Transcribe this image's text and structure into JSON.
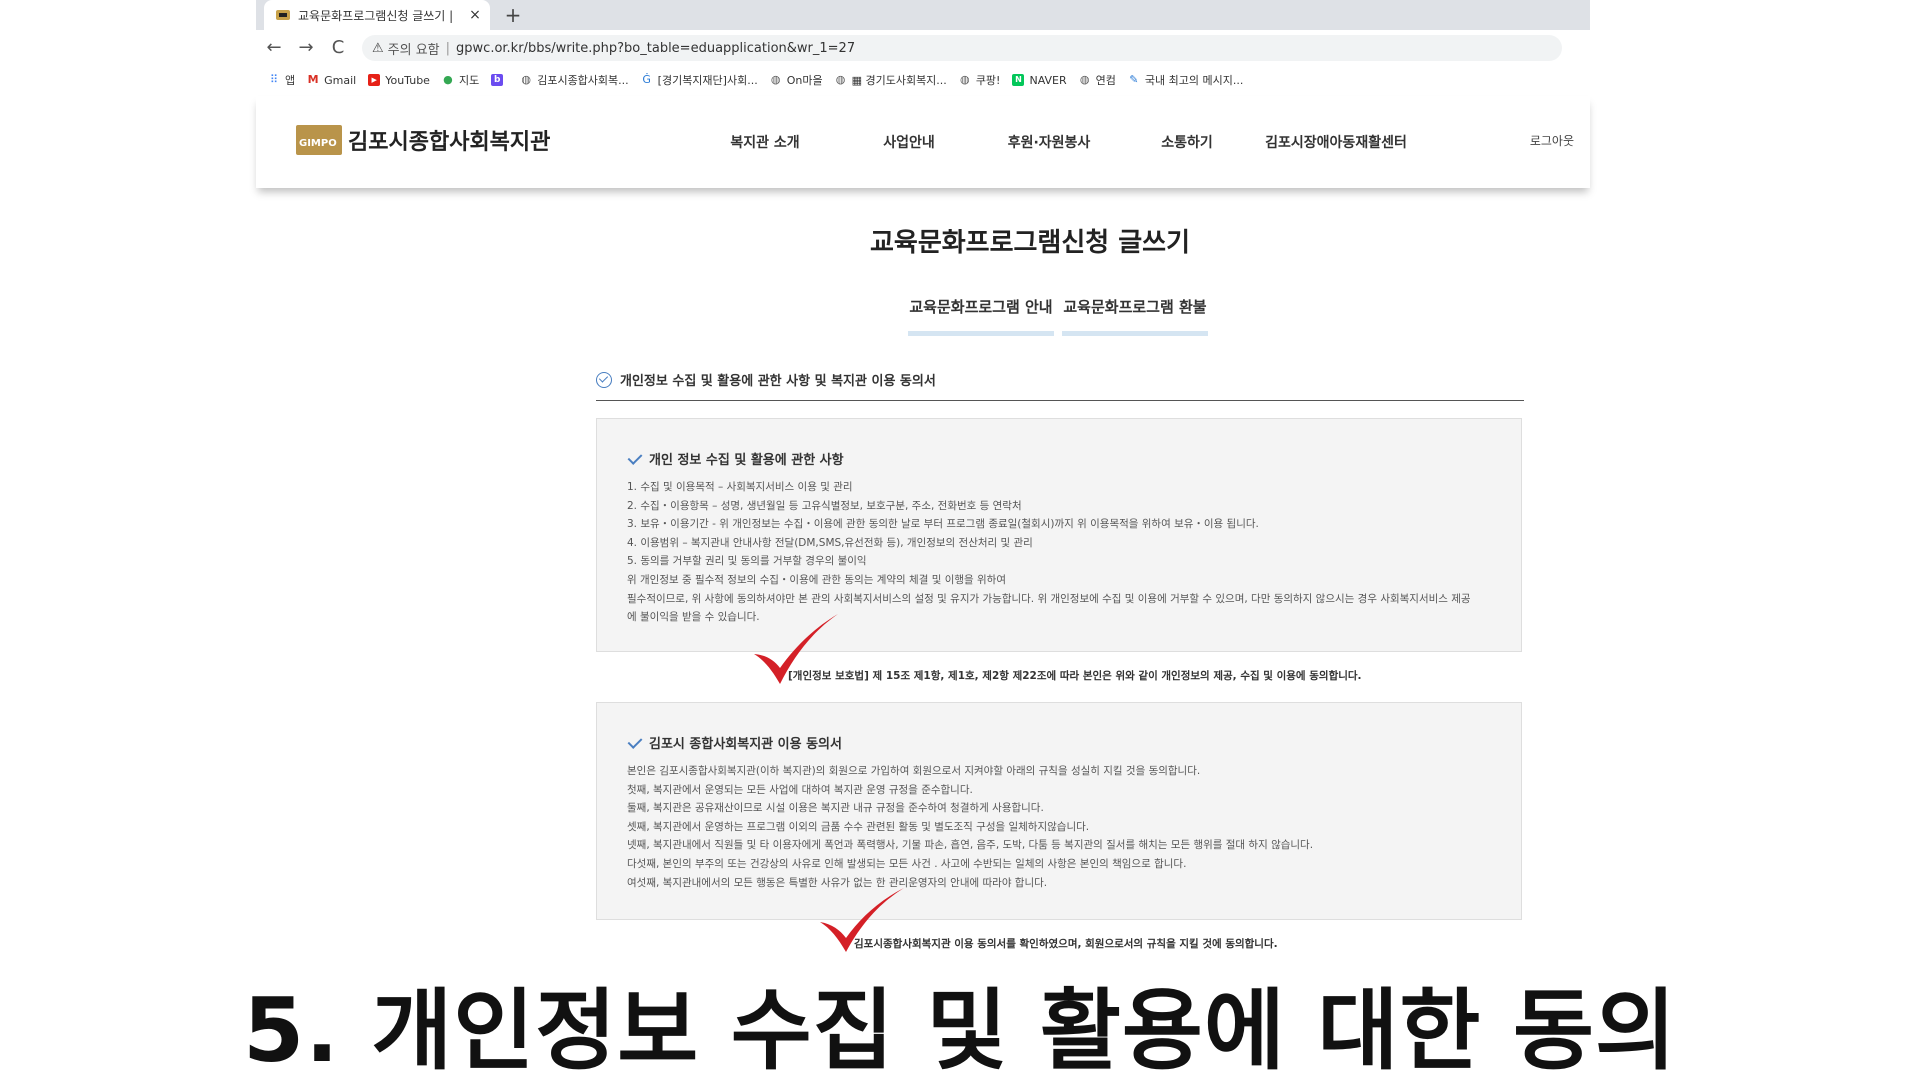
{
  "browser": {
    "tab_title": "교육문화프로그램신청 글쓰기 |",
    "tab_close": "×",
    "new_tab": "+",
    "nav_back": "←",
    "nav_forward": "→",
    "nav_reload": "C",
    "security_icon": "warning-icon",
    "security_text": "주의 요함",
    "url": "gpwc.or.kr/bbs/write.php?bo_table=eduapplication&wr_1=27",
    "bookmarks": [
      {
        "label": "앱",
        "icon": "apps-grid-icon",
        "color": "#4285f4"
      },
      {
        "label": "Gmail",
        "icon": "gmail-icon",
        "color": "#d93025"
      },
      {
        "label": "YouTube",
        "icon": "youtube-icon",
        "color": "#e62117"
      },
      {
        "label": "지도",
        "icon": "maps-pin-icon",
        "color": "#34a853"
      },
      {
        "label": "",
        "icon": "band-icon",
        "color": "#6b4cf0"
      },
      {
        "label": "김포시종합사회복...",
        "icon": "globe-icon",
        "color": "#555555"
      },
      {
        "label": "[경기복지재단]사회...",
        "icon": "ggwf-icon",
        "color": "#2a7bd6"
      },
      {
        "label": "On마을",
        "icon": "globe-icon",
        "color": "#555555"
      },
      {
        "label": "▦ 경기도사회복지...",
        "icon": "globe-icon",
        "color": "#555555"
      },
      {
        "label": "쿠팡!",
        "icon": "globe-icon",
        "color": "#555555"
      },
      {
        "label": "NAVER",
        "icon": "naver-icon",
        "color": "#03c75a"
      },
      {
        "label": "연컴",
        "icon": "globe-icon",
        "color": "#555555"
      },
      {
        "label": "국내 최고의 메시지...",
        "icon": "message-icon",
        "color": "#2a7bd6"
      }
    ]
  },
  "site": {
    "logo_emblem": "GIMPO",
    "logo_text": "김포시종합사회복지관",
    "nav": [
      "복지관 소개",
      "사업안내",
      "후원·자원봉사",
      "소통하기",
      "김포시장애아동재활센터"
    ],
    "logout": "로그아웃"
  },
  "page": {
    "title": "교육문화프로그램신청 글쓰기",
    "subtabs": [
      "교육문화프로그램 안내",
      "교육문화프로그램 환불"
    ],
    "section_heading": "개인정보 수집 및 활용에 관한 사항 및 복지관 이용 동의서"
  },
  "box1": {
    "title": "개인 정보 수집 및 활용에 관한 사항",
    "lines": [
      "1. 수집 및 이용목적 – 사회복지서비스 이용 및 관리",
      "2. 수집・이용항목 – 성명, 생년월일 등 고유식별정보, 보호구분, 주소, 전화번호 등 연락처",
      "3. 보유・이용기간 - 위 개인정보는 수집・이용에 관한 동의한 날로 부터 프로그램 종료일(철회시)까지 위 이용목적을 위하여 보유・이용 됩니다.",
      "4. 이용범위 – 복지관내 안내사항 전달(DM,SMS,유선전화 등), 개인정보의 전산처리 및 관리",
      "5. 동의를 거부할 권리 및 동의를 거부할 경우의 불이익",
      "위 개인정보 중 필수적 정보의 수집・이용에 관한 동의는 계약의 체결 및 이행을 위하여",
      "필수적이므로, 위 사항에 동의하셔야만 본 관의 사회복지서비스의 설정 및 유지가 가능합니다. 위 개인정보에 수집 및 이용에 거부할 수 있으며, 다만 동의하지 않으시는 경우 사회복지서비스 제공",
      "에 불이익을 받을 수 있습니다."
    ],
    "agree": "[개인정보 보호법] 제 15조 제1항, 제1호, 제2항 제22조에 따라 본인은 위와 같이 개인정보의 제공, 수집 및 이용에 동의합니다."
  },
  "box2": {
    "title": "김포시 종합사회복지관 이용 동의서",
    "lines": [
      "본인은 김포시종합사회복지관(이하 복지관)의 회원으로 가입하여 회원으로서 지켜야할 아래의 규칙을 성실히 지킬 것을 동의합니다.",
      "첫째, 복지관에서 운영되는 모든 사업에 대하여 복지관 운영 규정을 준수합니다.",
      "둘째, 복지관은 공유재산이므로 시설 이용은 복지관 내규 규정을 준수하여 청결하게 사용합니다.",
      "셋째, 복지관에서 운영하는 프로그램 이외의 금품 수수 관련된 활동 및 별도조직 구성을 일체하지않습니다.",
      "넷째, 복지관내에서 직원들 및 타 이용자에게 폭언과 폭력행사, 기물 파손, 흡연, 음주, 도박, 다툼 등 복지관의 질서를 해치는 모든 행위를 절대 하지 않습니다.",
      "다섯째, 본인의 부주의 또는 건강상의 사유로 인해 발생되는 모든 사건 . 사고에 수반되는 일체의 사항은 본인의 책임으로 합니다.",
      "여섯째, 복지관내에서의 모든 행동은 특별한 사유가 없는 한 관리운영자의 안내에 따라야 합니다."
    ],
    "agree": "김포시종합사회복지관 이용 동의서를 확인하였으며, 회원으로서의 규칙을 지킬 것에 동의합니다."
  },
  "colors": {
    "checkmark": "#d42027",
    "accent": "#4a7fc1",
    "tab_underline": "#d5e5f2"
  },
  "caption": "5. 개인정보 수집 및 활용에 대한 동의"
}
